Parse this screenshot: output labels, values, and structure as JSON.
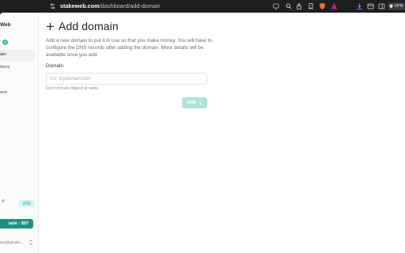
{
  "browser": {
    "url_host": "stakeweb.com",
    "url_path": "/dashboard/add-domain",
    "vpn_label": "VPN"
  },
  "sidebar": {
    "brand": "Web",
    "credit_count": "2",
    "items": [
      {
        "label": "ain",
        "active": true
      },
      {
        "label": "tions",
        "active": false
      },
      {
        "label": "ace",
        "active": false
      }
    ],
    "usage": "2/10",
    "upgrade_label": "rade - $97",
    "account_email": "son@gmail.c..."
  },
  "main": {
    "title": "Add domain",
    "description": "Add a new domain to put it in use so that you make money. You will have to configure the DNS records after adding the domain. More details will be available once you add",
    "field_label": "Domain",
    "field_placeholder": "Ex: mydomain.com",
    "field_value": "",
    "hint": "Don't include https:// or www.",
    "add_button_label": "Add"
  },
  "colors": {
    "accent": "#1f8f80",
    "accent_disabled": "#aee3d9",
    "badge": "#3fb4a3"
  }
}
